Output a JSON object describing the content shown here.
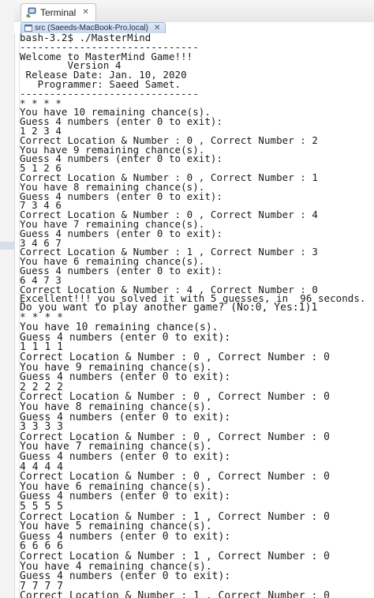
{
  "tab": {
    "title": "Terminal",
    "close": "✕",
    "icon": "terminal-icon"
  },
  "session": {
    "title": "src (Saeeds-MacBook-Pro.local)",
    "close": "✕",
    "icon": "console-icon"
  },
  "console_lines": [
    "bash-3.2$ ./MasterMind",
    "------------------------------",
    "Welcome to MasterMind Game!!!",
    "        Version 4",
    " Release Date: Jan. 10, 2020",
    "   Programmer: Saeed Samet.",
    "------------------------------",
    "* * * *",
    "You have 10 remaining chance(s).",
    "Guess 4 numbers (enter 0 to exit):",
    "1 2 3 4",
    "Correct Location & Number : 0 , Correct Number : 2",
    "You have 9 remaining chance(s).",
    "Guess 4 numbers (enter 0 to exit):",
    "5 1 2 6",
    "Correct Location & Number : 0 , Correct Number : 1",
    "You have 8 remaining chance(s).",
    "Guess 4 numbers (enter 0 to exit):",
    "7 3 4 6",
    "Correct Location & Number : 0 , Correct Number : 4",
    "You have 7 remaining chance(s).",
    "Guess 4 numbers (enter 0 to exit):",
    "3 4 6 7",
    "Correct Location & Number : 1 , Correct Number : 3",
    "You have 6 remaining chance(s).",
    "Guess 4 numbers (enter 0 to exit):",
    "6 4 7 3",
    "Correct Location & Number : 4 , Correct Number : 0",
    "Excellent!!! you solved it with 5 guesses, in  96 seconds.",
    "Do you want to play another game? (No:0, Yes:1)1",
    "* * * *",
    "You have 10 remaining chance(s).",
    "Guess 4 numbers (enter 0 to exit):",
    "1 1 1 1",
    "Correct Location & Number : 0 , Correct Number : 0",
    "You have 9 remaining chance(s).",
    "Guess 4 numbers (enter 0 to exit):",
    "2 2 2 2",
    "Correct Location & Number : 0 , Correct Number : 0",
    "You have 8 remaining chance(s).",
    "Guess 4 numbers (enter 0 to exit):",
    "3 3 3 3",
    "Correct Location & Number : 0 , Correct Number : 0",
    "You have 7 remaining chance(s).",
    "Guess 4 numbers (enter 0 to exit):",
    "4 4 4 4",
    "Correct Location & Number : 0 , Correct Number : 0",
    "You have 6 remaining chance(s).",
    "Guess 4 numbers (enter 0 to exit):",
    "5 5 5 5",
    "Correct Location & Number : 1 , Correct Number : 0",
    "You have 5 remaining chance(s).",
    "Guess 4 numbers (enter 0 to exit):",
    "6 6 6 6",
    "Correct Location & Number : 1 , Correct Number : 0",
    "You have 4 remaining chance(s).",
    "Guess 4 numbers (enter 0 to exit):",
    "7 7 7 7",
    "Correct Location & Number : 1 , Correct Number : 0"
  ]
}
